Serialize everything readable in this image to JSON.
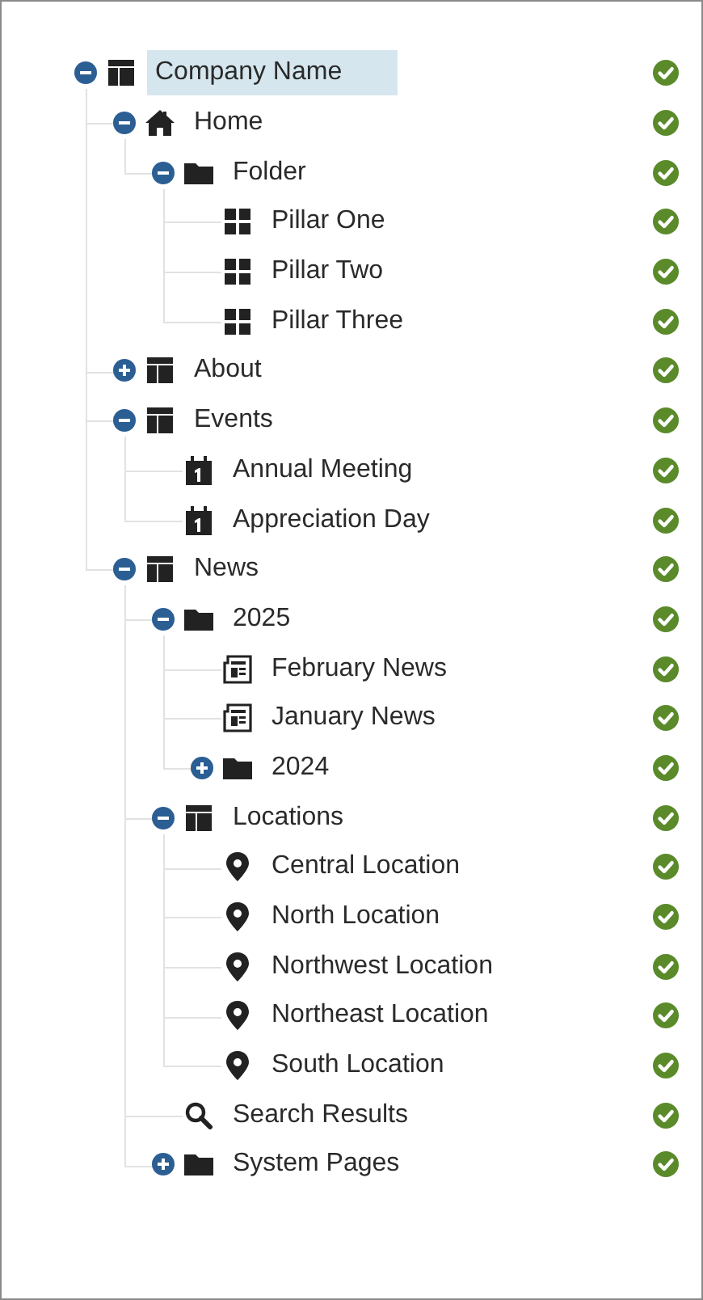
{
  "tree": [
    {
      "label": "Company Name",
      "kind": "page",
      "selected": true,
      "expanded": true,
      "published": true,
      "children": [
        {
          "label": "Home",
          "kind": "home",
          "selected": false,
          "expanded": true,
          "published": true,
          "children": [
            {
              "label": "Folder",
              "kind": "folder",
              "selected": false,
              "expanded": true,
              "published": true,
              "children": [
                {
                  "label": "Pillar One",
                  "kind": "block",
                  "selected": false,
                  "published": true
                },
                {
                  "label": "Pillar Two",
                  "kind": "block",
                  "selected": false,
                  "published": true
                },
                {
                  "label": "Pillar Three",
                  "kind": "block",
                  "selected": false,
                  "published": true
                }
              ]
            }
          ]
        },
        {
          "label": "About",
          "kind": "page",
          "selected": false,
          "expanded": false,
          "published": true
        },
        {
          "label": "Events",
          "kind": "page",
          "selected": false,
          "expanded": true,
          "published": true,
          "children": [
            {
              "label": "Annual Meeting",
              "kind": "event",
              "selected": false,
              "published": true
            },
            {
              "label": "Appreciation Day",
              "kind": "event",
              "selected": false,
              "published": true
            }
          ]
        },
        {
          "label": "News",
          "kind": "page",
          "selected": false,
          "expanded": true,
          "published": true,
          "children": [
            {
              "label": "2025",
              "kind": "folder",
              "selected": false,
              "expanded": true,
              "published": true,
              "children": [
                {
                  "label": "February News",
                  "kind": "article",
                  "selected": false,
                  "published": true
                },
                {
                  "label": "January News",
                  "kind": "article",
                  "selected": false,
                  "published": true
                },
                {
                  "label": "2024",
                  "kind": "folder",
                  "selected": false,
                  "expanded": false,
                  "published": true
                }
              ]
            },
            {
              "label": "Locations",
              "kind": "page",
              "selected": false,
              "expanded": true,
              "published": true,
              "children": [
                {
                  "label": "Central Location",
                  "kind": "location",
                  "selected": false,
                  "published": true
                },
                {
                  "label": "North Location",
                  "kind": "location",
                  "selected": false,
                  "published": true
                },
                {
                  "label": "Northwest Location",
                  "kind": "location",
                  "selected": false,
                  "published": true
                },
                {
                  "label": "Northeast Location",
                  "kind": "location",
                  "selected": false,
                  "published": true
                },
                {
                  "label": "South Location",
                  "kind": "location",
                  "selected": false,
                  "published": true
                }
              ]
            },
            {
              "label": "Search Results",
              "kind": "search",
              "selected": false,
              "published": true
            },
            {
              "label": "System Pages",
              "kind": "folder",
              "selected": false,
              "expanded": false,
              "published": true
            }
          ]
        }
      ]
    }
  ]
}
